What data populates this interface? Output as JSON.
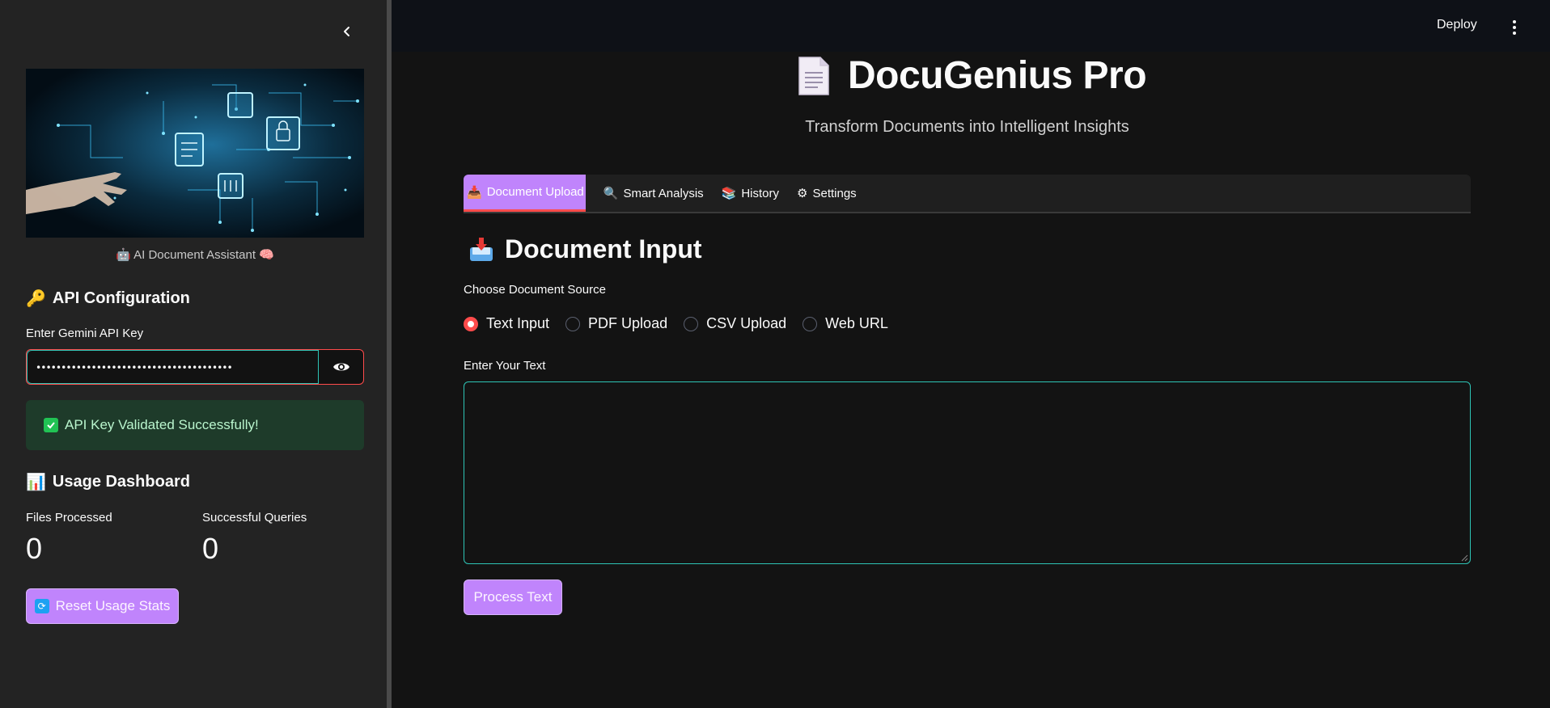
{
  "sidebar": {
    "caption": "🤖 AI Document Assistant 🧠",
    "api_section": {
      "heading": "API Configuration",
      "heading_icon": "🔑",
      "key_label": "Enter Gemini API Key",
      "key_value": "•••••••••••••••••••••••••••••••••••••••"
    },
    "success_message": "API Key Validated Successfully!",
    "usage": {
      "heading": "Usage Dashboard",
      "heading_icon": "📊",
      "metrics": [
        {
          "label": "Files Processed",
          "value": "0"
        },
        {
          "label": "Successful Queries",
          "value": "0"
        }
      ],
      "reset_label": "Reset Usage Stats"
    }
  },
  "header": {
    "deploy_label": "Deploy"
  },
  "main": {
    "title": "DocuGenius Pro",
    "subtitle": "Transform Documents into Intelligent Insights",
    "tabs": [
      {
        "icon": "📥",
        "label": "Document Upload",
        "active": true
      },
      {
        "icon": "🔍",
        "label": "Smart Analysis",
        "active": false
      },
      {
        "icon": "📚",
        "label": "History",
        "active": false
      },
      {
        "icon": "⚙",
        "label": "Settings",
        "active": false
      }
    ],
    "section_heading": "Document Input",
    "source_label": "Choose Document Source",
    "source_options": [
      "Text Input",
      "PDF Upload",
      "CSV Upload",
      "Web URL"
    ],
    "selected_source": "Text Input",
    "text_label": "Enter Your Text",
    "text_value": "",
    "process_label": "Process Text"
  },
  "colors": {
    "accent_button": "#c084fc",
    "radio_selected": "#ff4b4b",
    "focus_border": "#2ec4b6",
    "success_bg": "#1e3b2a"
  }
}
